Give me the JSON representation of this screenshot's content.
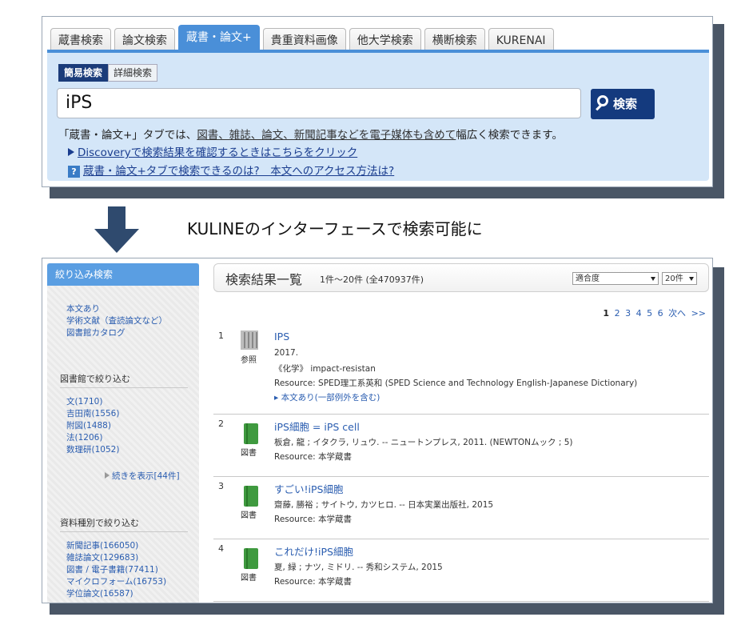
{
  "top": {
    "tabs": [
      "蔵書検索",
      "論文検索",
      "蔵書・論文+",
      "貴重資料画像",
      "他大学検索",
      "横断検索",
      "KURENAI"
    ],
    "subtabs": [
      "簡易検索",
      "詳細検索"
    ],
    "query": "iPS",
    "search_button": "検索",
    "description_pre": "「蔵書・論文+」タブでは、",
    "description_link": "図書、雑誌、論文、新聞記事などを電子媒体も含めて",
    "description_post": "幅広く検索できます。",
    "discovery_link": "Discoveryで検索結果を確認するときはこちらをクリック",
    "help_icon": "?",
    "help_link": "蔵書・論文+タブで検索できるのは?　本文へのアクセス方法は?"
  },
  "caption": "KULINEのインターフェースで検索可能に",
  "sidebar": {
    "header": "絞り込み検索",
    "top_links": [
      "本文あり",
      "学術文献（査読論文など）",
      "図書館カタログ"
    ],
    "library_title": "図書館で絞り込む",
    "libraries": [
      "文(1710)",
      "吉田南(1556)",
      "附図(1488)",
      "法(1206)",
      "数理研(1052)"
    ],
    "more": "続きを表示[44件]",
    "type_title": "資料種別で絞り込む",
    "types": [
      "新聞記事(166050)",
      "雑誌論文(129683)",
      "図書 / 電子書籍(77411)",
      "マイクロフォーム(16753)",
      "学位論文(16587)"
    ]
  },
  "results": {
    "title": "検索結果一覧",
    "count": "1件〜20件 (全470937件)",
    "sort": "適合度",
    "per_page": "20件",
    "pager": {
      "current": "1",
      "pages": [
        "2",
        "3",
        "4",
        "5",
        "6"
      ],
      "next": "次へ",
      "last": ">>"
    },
    "items": [
      {
        "num": "1",
        "type": "参照",
        "title": "IPS",
        "lines": [
          "2017.",
          "《化学》 impact-resistan",
          "Resource: SPED理工系英和 (SPED Science and Technology English-Japanese Dictionary)"
        ],
        "fulltext": "本文あり(一部例外を含む)"
      },
      {
        "num": "2",
        "type": "図書",
        "title": "iPS細胞 = iPS cell",
        "lines": [
          "板倉, 龍 ; イタクラ, リュウ. -- ニュートンプレス, 2011. (NEWTONムック ; 5)",
          "Resource: 本学蔵書"
        ]
      },
      {
        "num": "3",
        "type": "図書",
        "title": "すごい!iPS細胞",
        "lines": [
          "齋藤, 勝裕 ; サイトウ, カツヒロ. -- 日本実業出版社, 2015",
          "Resource: 本学蔵書"
        ]
      },
      {
        "num": "4",
        "type": "図書",
        "title": "これだけ!iPS細胞",
        "lines": [
          "夏, 緑 ; ナツ, ミドリ. -- 秀和システム, 2015",
          "Resource: 本学蔵書"
        ]
      }
    ]
  }
}
